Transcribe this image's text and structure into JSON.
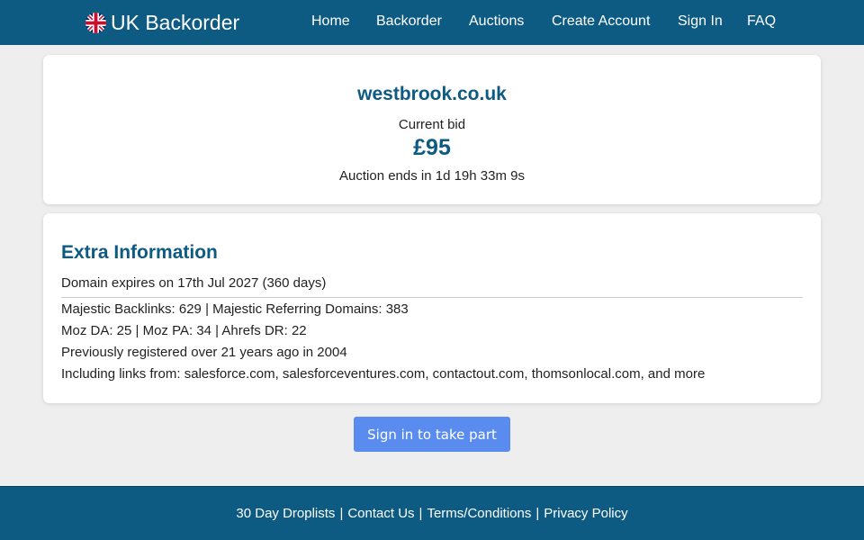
{
  "header": {
    "brand": "UK Backorder",
    "nav": [
      "Home",
      "Backorder",
      "Auctions",
      "Create Account",
      "Sign In",
      "FAQ"
    ]
  },
  "auction": {
    "domain": "westbrook.co.uk",
    "bid_label": "Current bid",
    "bid_value": "£95",
    "ends": "Auction ends in 1d 19h 33m 9s"
  },
  "extra": {
    "heading": "Extra Information",
    "expires": "Domain expires on 17th Jul 2027 (360 days)",
    "lines": [
      "Majestic Backlinks: 629 | Majestic Referring Domains: 383",
      "Moz DA: 25 | Moz PA: 34 | Ahrefs DR: 22",
      "Previously registered over 21 years ago in 2004",
      "Including links from: salesforce.com, salesforceventures.com, contactout.com, thomsonlocal.com, and more"
    ]
  },
  "cta": {
    "label": "Sign in to take part"
  },
  "footer": {
    "links": [
      "30 Day Droplists",
      "Contact Us",
      "Terms/Conditions",
      "Privacy Policy"
    ],
    "separator": "|"
  },
  "colors": {
    "brand": "#0d5a83",
    "button": "#5a8cf0",
    "page_bg": "#eeeeee"
  },
  "icons": {
    "logo": "uk-flag-icon"
  }
}
